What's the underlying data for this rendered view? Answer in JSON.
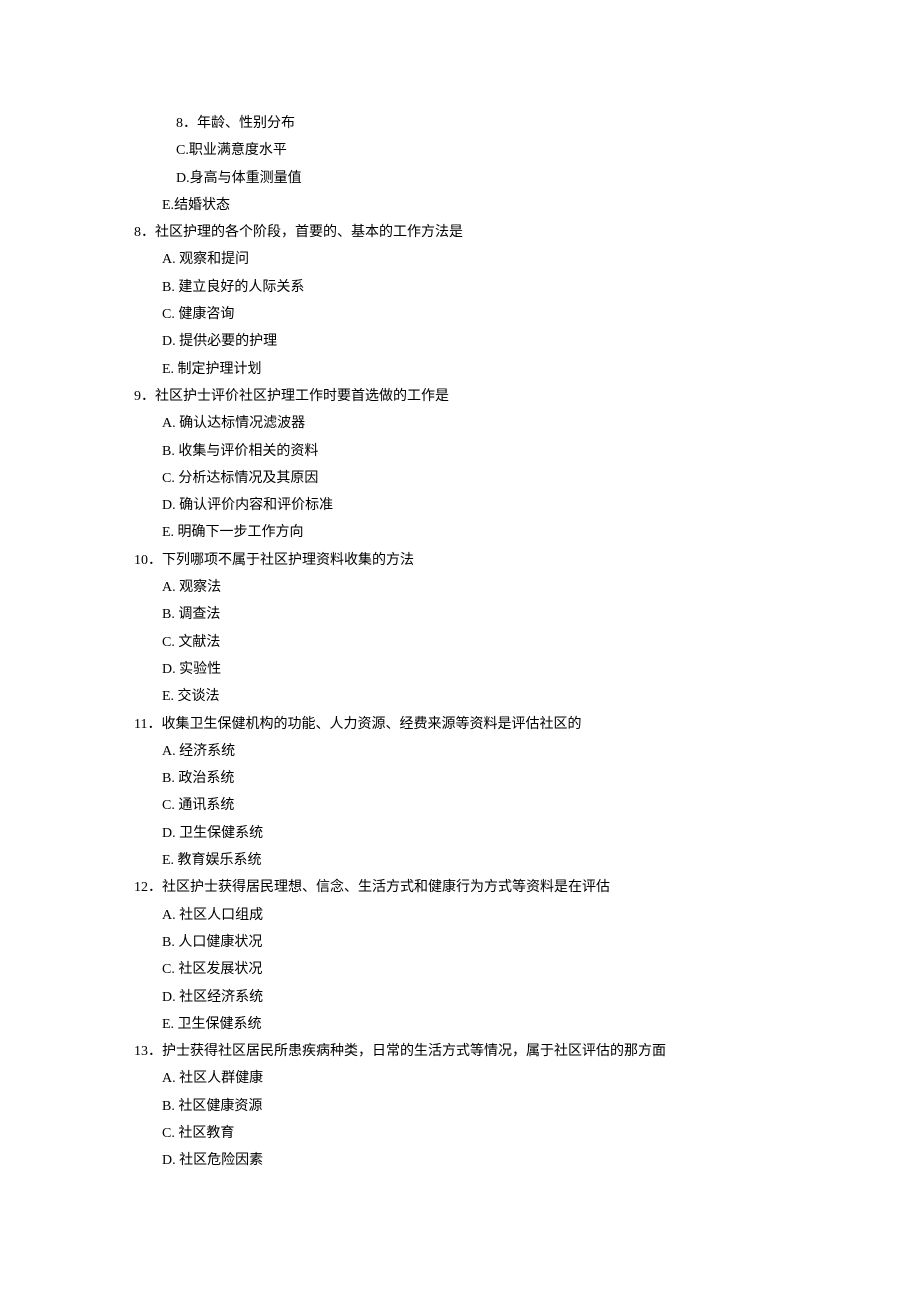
{
  "lead_options": [
    {
      "label": "8",
      "text": "．年龄、性别分布",
      "deep": true
    },
    {
      "label": "C.",
      "text": "职业满意度水平",
      "deep": true
    },
    {
      "label": "D.",
      "text": "身高与体重测量值",
      "deep": true
    },
    {
      "label": "E.",
      "text": "结婚状态",
      "deep": false
    }
  ],
  "questions": [
    {
      "num": "8",
      "stem": "．社区护理的各个阶段，首要的、基本的工作方法是",
      "options": [
        "A. 观察和提问",
        "B. 建立良好的人际关系",
        "C. 健康咨询",
        "D. 提供必要的护理",
        "E. 制定护理计划"
      ]
    },
    {
      "num": "9",
      "stem": "．社区护士评价社区护理工作时要首选做的工作是",
      "options": [
        "A. 确认达标情况滤波器",
        "B. 收集与评价相关的资料",
        "C. 分析达标情况及其原因",
        "D. 确认评价内容和评价标准",
        "E. 明确下一步工作方向"
      ]
    },
    {
      "num": "10",
      "stem": "．下列哪项不属于社区护理资料收集的方法",
      "options": [
        "A. 观察法",
        "B. 调查法",
        "C. 文献法",
        "D. 实验性",
        "E. 交谈法"
      ]
    },
    {
      "num": "11",
      "stem": "．收集卫生保健机构的功能、人力资源、经费来源等资料是评估社区的",
      "options": [
        "A. 经济系统",
        "B. 政治系统",
        "C. 通讯系统",
        "D. 卫生保健系统",
        "E. 教育娱乐系统"
      ]
    },
    {
      "num": "12",
      "stem": "．社区护士获得居民理想、信念、生活方式和健康行为方式等资料是在评估",
      "options": [
        "A. 社区人口组成",
        "B. 人口健康状况",
        "C. 社区发展状况",
        "D. 社区经济系统",
        "E. 卫生保健系统"
      ]
    },
    {
      "num": "13",
      "stem": "．护士获得社区居民所患疾病种类，日常的生活方式等情况，属于社区评估的那方面",
      "options": [
        "A. 社区人群健康",
        "B. 社区健康资源",
        "C. 社区教育",
        "D. 社区危险因素"
      ]
    }
  ]
}
